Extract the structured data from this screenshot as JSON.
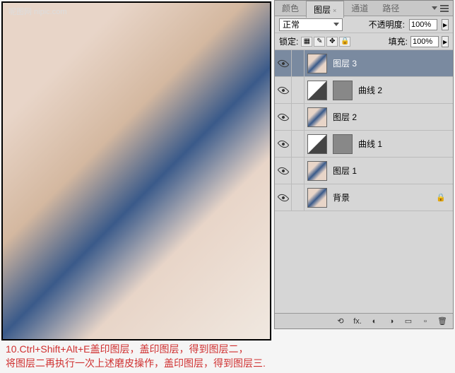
{
  "canvas": {
    "watermark": "呢图网 nipic.com"
  },
  "palette": {
    "tabs": {
      "color": "颜色",
      "layers": "图层",
      "channels": "通道",
      "paths": "路径"
    },
    "blend_mode": "正常",
    "opacity_label": "不透明度:",
    "opacity_value": "100%",
    "lock_label": "锁定:",
    "fill_label": "填充:",
    "fill_value": "100%",
    "layers": [
      {
        "name": "图层 3",
        "type": "image",
        "selected": true
      },
      {
        "name": "曲线 2",
        "type": "adjustment"
      },
      {
        "name": "图层 2",
        "type": "image"
      },
      {
        "name": "曲线 1",
        "type": "adjustment"
      },
      {
        "name": "图层 1",
        "type": "image"
      },
      {
        "name": "背景",
        "type": "bg"
      }
    ],
    "footer_icons": {
      "link": "⟲",
      "fx": "fx.",
      "mask": "◐",
      "adj": "◑",
      "folder": "▭",
      "new": "▫",
      "trash": "🗑"
    }
  },
  "instruction": {
    "line1": "10.Ctrl+Shift+Alt+E盖印图层，盖印图层，得到图层二，",
    "line2": "将图层二再执行一次上述磨皮操作，盖印图层，得到图层三."
  }
}
